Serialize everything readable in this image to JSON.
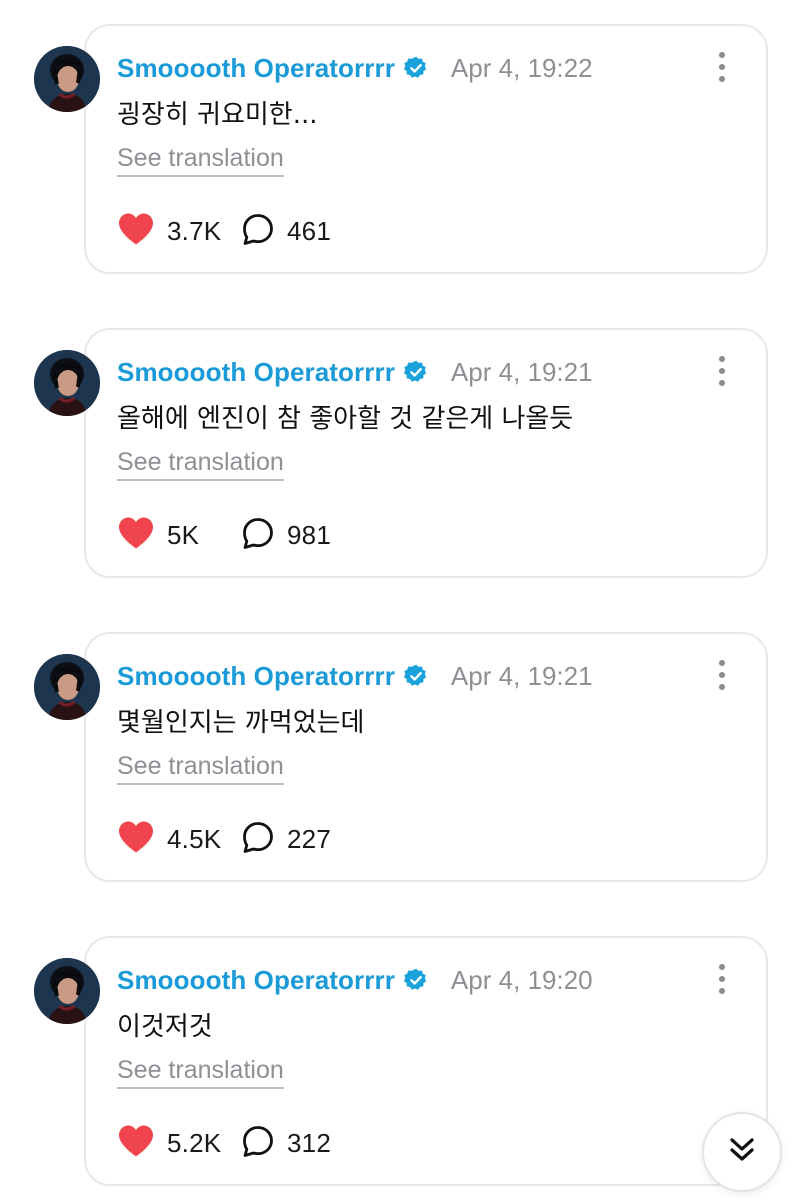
{
  "theme": {
    "accent": "#1a9ad6",
    "verified_badge": "#1aa3db",
    "like_color": "#f0444f",
    "muted_text": "#8f8f95",
    "card_border": "#e8e8ec"
  },
  "posts": [
    {
      "author": "Smooooth Operatorrrr",
      "verified": true,
      "timestamp": "Apr 4, 19:22",
      "text": "굉장히 귀요미한...",
      "translate_label": "See translation",
      "likes": "3.7K",
      "comments": "461"
    },
    {
      "author": "Smooooth Operatorrrr",
      "verified": true,
      "timestamp": "Apr 4, 19:21",
      "text": "올해에 엔진이 참 좋아할 것 같은게 나올듯",
      "translate_label": "See translation",
      "likes": "5K",
      "comments": "981"
    },
    {
      "author": "Smooooth Operatorrrr",
      "verified": true,
      "timestamp": "Apr 4, 19:21",
      "text": "몇월인지는 까먹었는데",
      "translate_label": "See translation",
      "likes": "4.5K",
      "comments": "227"
    },
    {
      "author": "Smooooth Operatorrrr",
      "verified": true,
      "timestamp": "Apr 4, 19:20",
      "text": "이것저것",
      "translate_label": "See translation",
      "likes": "5.2K",
      "comments": "312"
    }
  ],
  "icons": {
    "like": "heart-icon",
    "comment": "speech-bubble-icon",
    "more": "more-vertical-icon",
    "verified": "verified-badge-icon",
    "scroll": "double-chevron-down-icon"
  }
}
